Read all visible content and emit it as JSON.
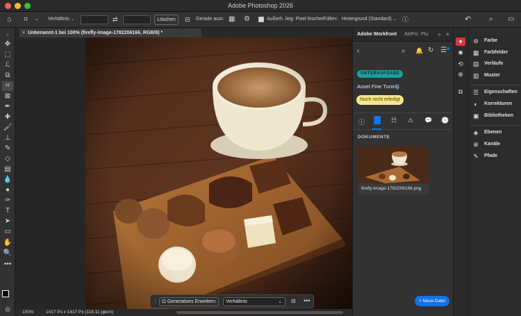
{
  "window": {
    "title": "Adobe Photoshop 2026"
  },
  "options": {
    "ratio_label": "Verhältnis",
    "clear_label": "Löschen",
    "straighten_label": "Gerade ausr.",
    "delete_pixels_label": "Außerh. lieg. Pixel löschen",
    "fill_label": "Füllen:",
    "fill_value": "Hintergrund (Standard)"
  },
  "document": {
    "tab_title": "Unbenannt-1 bei 100% (firefly-image-1782206166, RGB/8) *",
    "zoom": "100%",
    "size": "1417 Px x 1417 Px (118,11 ppcm)"
  },
  "context_bar": {
    "generative_label": "Generatives Erweitern",
    "ratio_value": "Verhältnis"
  },
  "workfront": {
    "tabs": [
      "Adobe Workfront",
      "Akt",
      "Prc",
      "Plu"
    ],
    "badge": "UNTERAUFGABE",
    "task_name": "Asset Fine Tuning",
    "status": "Noch nicht erledigt",
    "docs_heading": "DOKUMENTE",
    "doc_filename": "firefly-image-1782206166.png",
    "new_file_label": "+ Neue Datei"
  },
  "dock": {
    "items": [
      "Farbe",
      "Farbfelder",
      "Verläufe",
      "Muster",
      "Eigenschaften",
      "Korrekturen",
      "Bibliotheken",
      "Ebenen",
      "Kanäle",
      "Pfade"
    ]
  },
  "colors": {
    "accent_blue": "#1473e6",
    "badge_teal": "#1b9e9e",
    "status_yellow": "#f7e58a",
    "traffic_red": "#fe5f57",
    "traffic_yellow": "#febc2e",
    "traffic_green": "#28c840"
  }
}
